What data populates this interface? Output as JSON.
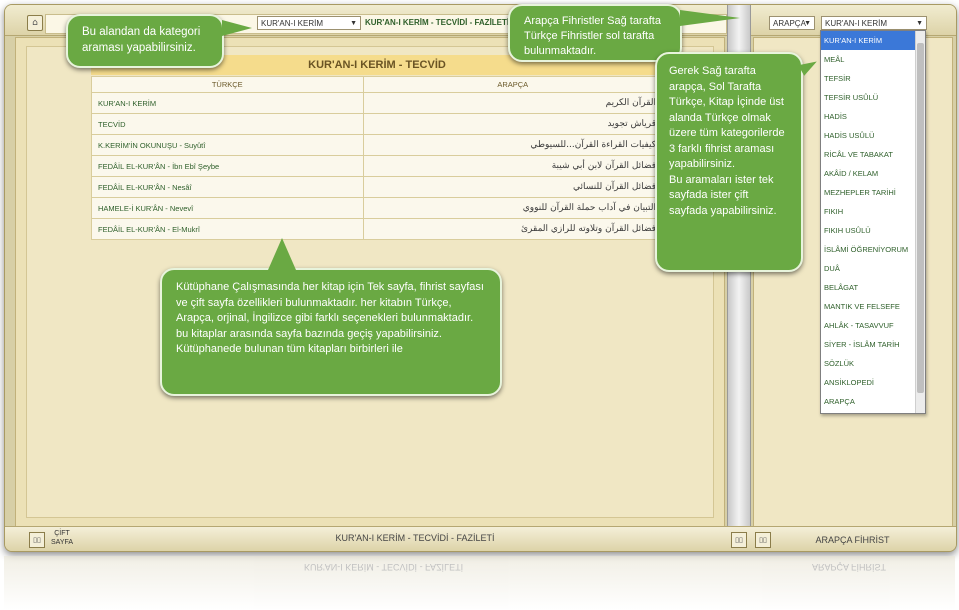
{
  "topbar": {
    "category_select": "KUR'AN-I KERİM",
    "book_title": "KUR'AN-I KERİM - TECVİDİ - FAZİLETİ",
    "lang_select": "ARAPÇA",
    "right_category_select": "KUR'AN-I KERİM"
  },
  "page": {
    "title": "KUR'AN-I KERİM - TECVİD",
    "col_left": "TÜRKÇE",
    "col_right": "ARAPÇA",
    "rows": [
      {
        "tr": "KUR'AN-I KERİM",
        "ar": "القرآن الكريم"
      },
      {
        "tr": "TECVİD",
        "ar": "قرياش تجويد"
      },
      {
        "tr": "K.KERİM'İN OKUNUŞU - Suyûtî",
        "ar": "كيفيات القراءة القرآن...للسيوطي"
      },
      {
        "tr": "FEDÂİL EL-KUR'ÂN - İbn Ebî Şeybe",
        "ar": "فضائل القرآن لابن أبي شيبة"
      },
      {
        "tr": "FEDÂİL EL-KUR'ÂN - Nesâî",
        "ar": "فضائل القرآن للنسائي"
      },
      {
        "tr": "HAMELE-İ KUR'ÂN - Nevevî",
        "ar": "التبيان في آداب حملة القرآن للنووي"
      },
      {
        "tr": "FEDÂİL EL-KUR'ÂN - El-Mukrî",
        "ar": "فضائل القرآن وتلاوته للرازي المقرئ"
      }
    ]
  },
  "bottombar": {
    "cift_line1": "ÇİFT",
    "cift_line2": "SAYFA",
    "title": "KUR'AN-I KERİM - TECVİDİ - FAZİLETİ",
    "right_title": "ARAPÇA FİHRİST"
  },
  "dropdown": {
    "items": [
      "KUR'AN-I KERİM",
      "MEÂL",
      "TEFSİR",
      "TEFSİR USÛLÜ",
      "HADİS",
      "HADİS USÛLÜ",
      "RİCÂL VE TABAKAT",
      "AKÂİD / KELAM",
      "MEZHEPLER TARİHİ",
      "FIKIH",
      "FIKIH USÛLÜ",
      "İSLÂMİ ÖĞRENİYORUM",
      "DUÂ",
      "BELÂGAT",
      "MANTIK VE FELSEFE",
      "AHLÂK - TASAVVUF",
      "SİYER - İSLÂM TARİH",
      "SÖZLÜK",
      "ANSİKLOPEDİ",
      "ARAPÇA"
    ],
    "selected_index": 0
  },
  "bubbles": {
    "b1": "Bu alandan da kategori araması yapabilirsiniz.",
    "b2": "Arapça Fihristler Sağ tarafta Türkçe Fihristler sol tarafta bulunmaktadır.",
    "b3_p1": "Gerek Sağ tarafta arapça, Sol Tarafta Türkçe, Kitap İçinde üst alanda Türkçe olmak üzere tüm kategorilerde 3 farklı fihrist araması yapabilirsiniz.",
    "b3_p2": "Bu aramaları ister tek sayfada ister çift sayfada yapabilirsiniz.",
    "b4_p1": "Kütüphane Çalışmasında her kitap için Tek sayfa, fihrist sayfası ve çift sayfa özellikleri bulunmaktadır. her kitabın Türkçe, Arapça, orjinal, İngilizce gibi farklı seçenekleri bulunmaktadır. bu kitaplar arasında sayfa bazında geçiş yapabilirsiniz.",
    "b4_p2": "Kütüphanede bulunan tüm kitapları birbirleri ile"
  },
  "colors": {
    "bubble": "#6aa943",
    "accent": "#2e5f2a",
    "selection": "#3b78d8"
  }
}
